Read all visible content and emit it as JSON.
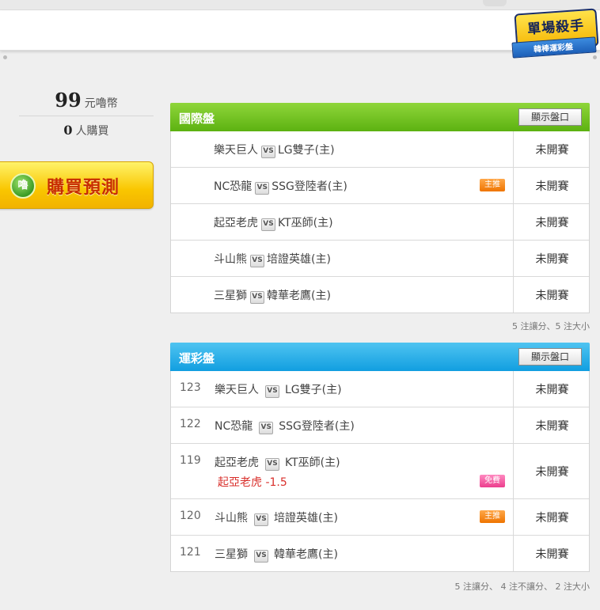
{
  "badge": {
    "title": "單場殺手",
    "subtitle": "韓棒運彩盤"
  },
  "price": {
    "value": "99",
    "unit": "元嚕幣"
  },
  "buyers": {
    "value": "0",
    "unit": "人購買"
  },
  "buy_button": {
    "coin": "嚕",
    "label": "購買預測"
  },
  "intl_panel": {
    "title": "國際盤",
    "show_button": "顯示盤口",
    "rows": [
      {
        "home": "樂天巨人",
        "vs": "VS",
        "away": "LG雙子(主)",
        "tag": "",
        "status": "未開賽"
      },
      {
        "home": "NC恐龍",
        "vs": "VS",
        "away": "SSG登陸者(主)",
        "tag": "主推",
        "status": "未開賽"
      },
      {
        "home": "起亞老虎",
        "vs": "VS",
        "away": "KT巫師(主)",
        "tag": "",
        "status": "未開賽"
      },
      {
        "home": "斗山熊",
        "vs": "VS",
        "away": "培證英雄(主)",
        "tag": "",
        "status": "未開賽"
      },
      {
        "home": "三星獅",
        "vs": "VS",
        "away": "韓華老鷹(主)",
        "tag": "",
        "status": "未開賽"
      }
    ],
    "footer": "5 注讓分、5 注大小"
  },
  "sport_panel": {
    "title": "運彩盤",
    "show_button": "顯示盤口",
    "rows": [
      {
        "no": "123",
        "home": "樂天巨人",
        "vs": "VS",
        "away": "LG雙子(主)",
        "tag": "",
        "pick": "",
        "status": "未開賽"
      },
      {
        "no": "122",
        "home": "NC恐龍",
        "vs": "VS",
        "away": "SSG登陸者(主)",
        "tag": "",
        "pick": "",
        "status": "未開賽"
      },
      {
        "no": "119",
        "home": "起亞老虎",
        "vs": "VS",
        "away": "KT巫師(主)",
        "tag": "免費",
        "pick": "起亞老虎 -1.5",
        "status": "未開賽"
      },
      {
        "no": "120",
        "home": "斗山熊",
        "vs": "VS",
        "away": "培證英雄(主)",
        "tag": "主推",
        "pick": "",
        "status": "未開賽"
      },
      {
        "no": "121",
        "home": "三星獅",
        "vs": "VS",
        "away": "韓華老鷹(主)",
        "tag": "",
        "pick": "",
        "status": "未開賽"
      }
    ],
    "footer": "5 注讓分、 4 注不讓分、 2 注大小"
  }
}
